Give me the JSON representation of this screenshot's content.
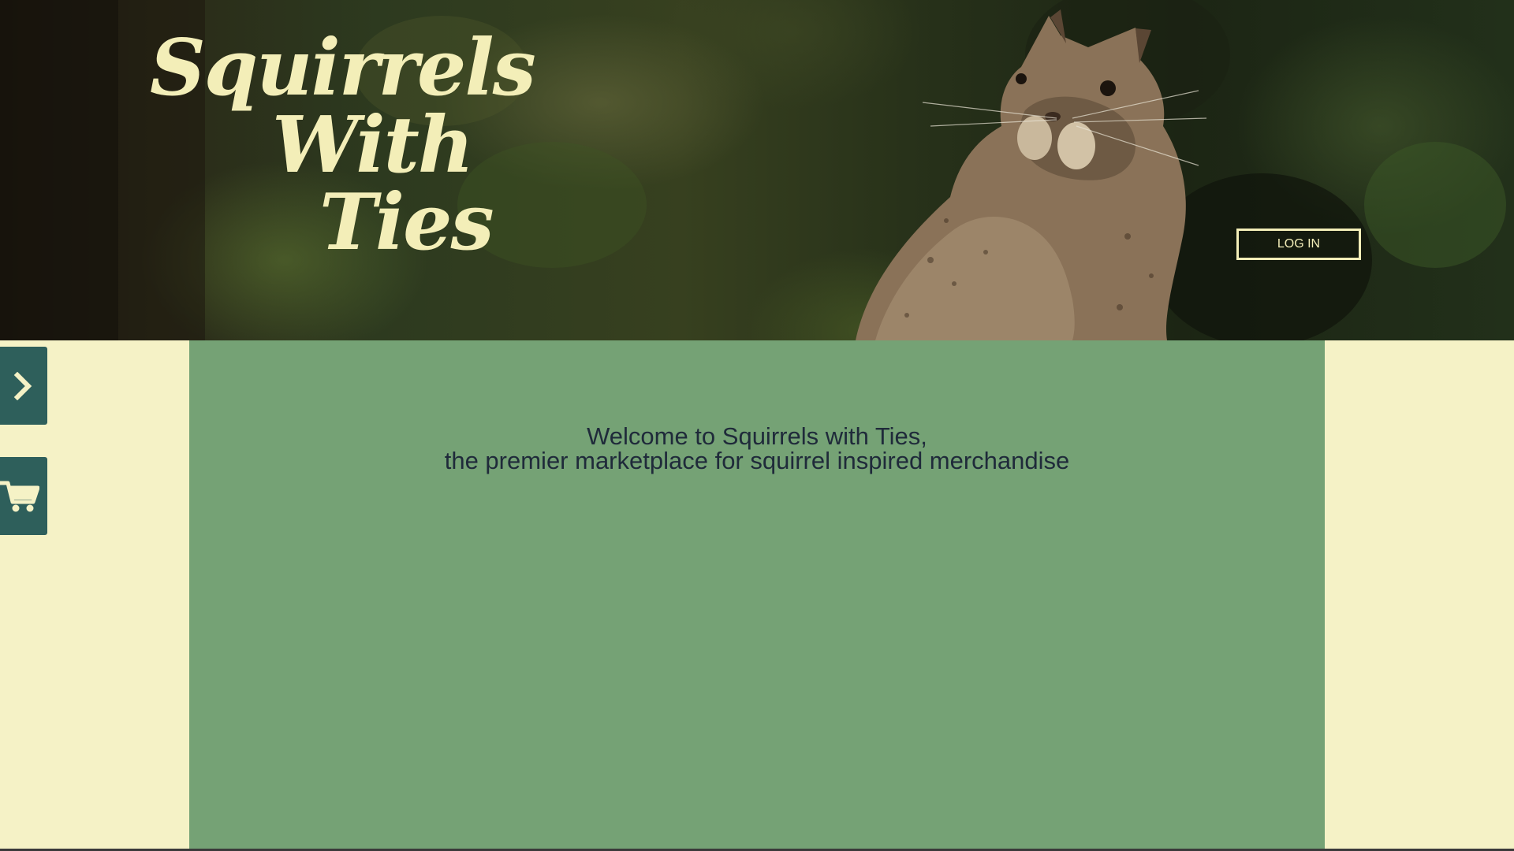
{
  "header": {
    "logo_lines": [
      "Squirrels",
      "With",
      "Ties"
    ],
    "login_label": "LOG IN"
  },
  "main": {
    "welcome_line_1": "Welcome to Squirrels with Ties,",
    "welcome_line_2": "the premier marketplace for squirrel inspired merchandise"
  },
  "sidebar": {
    "toggle_icon": "chevron-right-icon",
    "cart_icon": "shopping-cart-icon"
  },
  "colors": {
    "background": "#f5f2c6",
    "panel": "#75a275",
    "accent": "#2e5f5b",
    "logo_text": "#f3eeb8",
    "body_text": "#1f2a3a"
  }
}
